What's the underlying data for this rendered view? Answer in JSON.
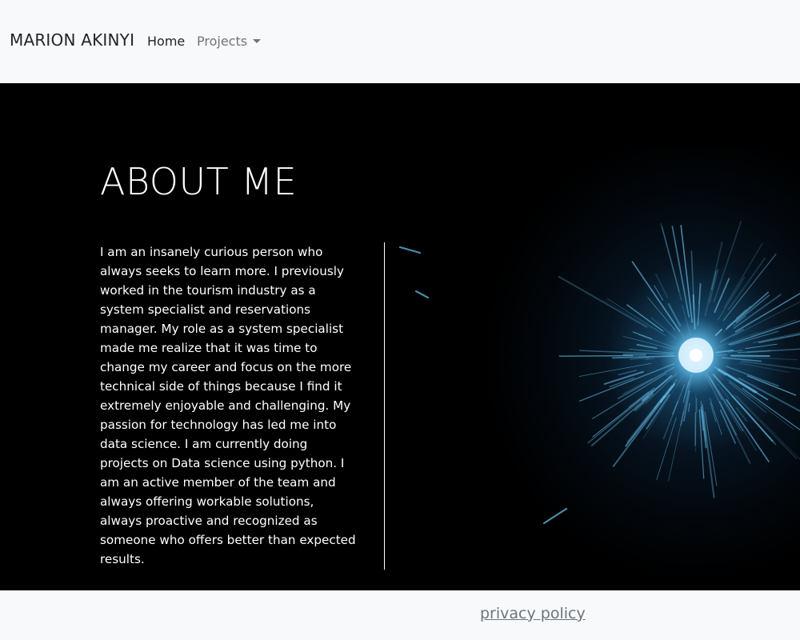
{
  "navbar": {
    "brand": "MARION AKINYI",
    "home_label": "Home",
    "projects_label": "Projects"
  },
  "hero": {
    "title": "ABOUT ME",
    "paragraph": "I am an insanely curious person who always seeks to learn more. I previously worked in the tourism industry as a system specialist and reservations manager. My role as a system specialist made me realize that it was time to change my career and focus on the more technical side of things because I find it extremely enjoyable and challenging. My passion for technology has led me into data science. I am currently doing projects on Data science using python. I am an active member of the team and always offering workable solutions, always proactive and recognized as someone who offers better than expected results."
  },
  "footer": {
    "privacy_label": "privacy policy"
  },
  "colors": {
    "navbar_bg": "#f8f9fa",
    "hero_bg": "#000000",
    "burst_core": "#8fd3ff",
    "link_muted": "#6c757d"
  }
}
